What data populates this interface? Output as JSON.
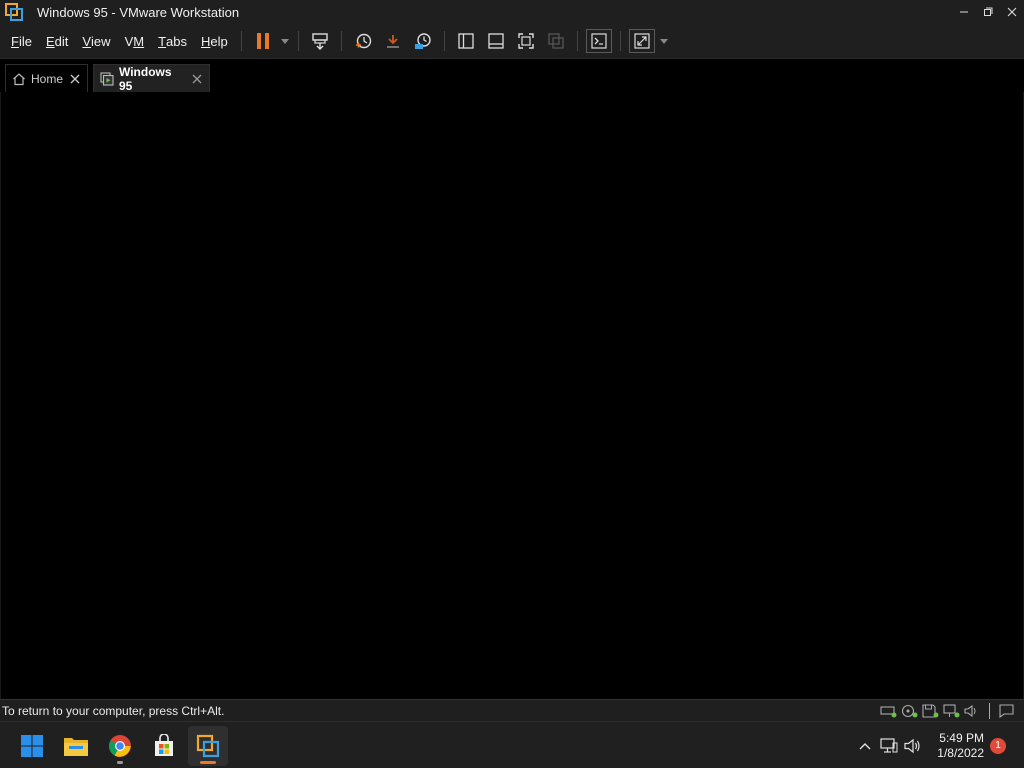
{
  "window": {
    "title": "Windows 95 - VMware Workstation"
  },
  "menu": [
    {
      "label": "File",
      "underline": "F",
      "rest": "ile"
    },
    {
      "label": "Edit",
      "underline": "E",
      "rest": "dit"
    },
    {
      "label": "View",
      "underline": "V",
      "rest": "iew"
    },
    {
      "label": "VM",
      "underline": "V",
      "rest": "M"
    },
    {
      "label": "Tabs",
      "underline": "T",
      "rest": "abs"
    },
    {
      "label": "Help",
      "underline": "H",
      "rest": "elp"
    }
  ],
  "tabs": {
    "home_label": "Home",
    "vm_label": "Windows 95"
  },
  "statusbar": {
    "hint": "To return to your computer, press Ctrl+Alt."
  },
  "taskbar": {
    "time": "5:49 PM",
    "date": "1/8/2022",
    "notification_count": "1"
  },
  "colors": {
    "accent_orange": "#e8792b",
    "chrome_bg": "#1f1f1f",
    "taskbar_bg": "#202020",
    "win_blue": "#2a8fe8"
  }
}
